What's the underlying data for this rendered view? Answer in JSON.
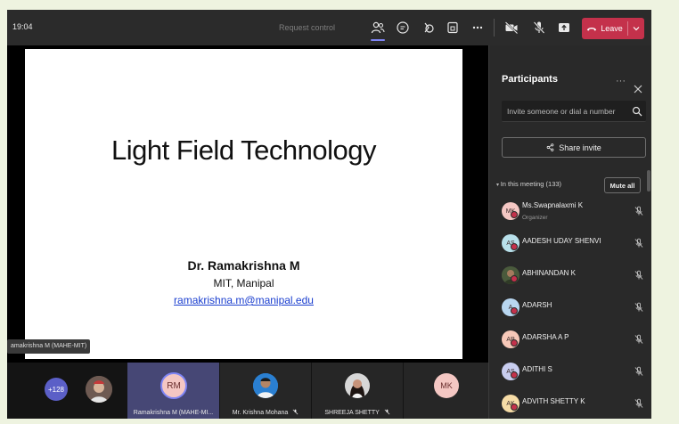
{
  "toolbar": {
    "time": "19:04",
    "request_control": "Request control",
    "leave_label": "Leave",
    "colors": {
      "leave": "#c4314b",
      "accent": "#7f85f5"
    }
  },
  "slide": {
    "title": "Light Field Technology",
    "author": "Dr. Ramakrishna M",
    "affiliation": "MIT, Manipal",
    "email": "ramakrishna.m@manipal.edu"
  },
  "presenter_label": "amakrishna M (MAHE-MIT)",
  "gallery": {
    "overflow_count": "+128",
    "tiles": [
      {
        "initials": "RM",
        "name": "Ramakrishna M (MAHE-MI...",
        "active": true
      },
      {
        "initials": "",
        "name": "Mr. Krishna Mohana",
        "muted_icon": "mic-off-icon"
      },
      {
        "initials": "",
        "name": "SHREEJA SHETTY",
        "muted_icon": "mic-off-icon"
      },
      {
        "initials": "MK",
        "name": ""
      }
    ]
  },
  "participants": {
    "title": "Participants",
    "search_placeholder": "Invite someone or dial a number",
    "share_invite": "Share invite",
    "section_label": "In this meeting (133)",
    "mute_all": "Mute all",
    "list": [
      {
        "initials": "MK",
        "name": "Ms.Swapnalaxmi K",
        "role": "Organizer",
        "color": "#f4c7c3"
      },
      {
        "initials": "AS",
        "name": "AADESH UDAY SHENVI",
        "role": "",
        "color": "#b8e0ea"
      },
      {
        "initials": "",
        "name": "ABHINANDAN K",
        "role": "",
        "color": "#4a5a3c"
      },
      {
        "initials": "A",
        "name": "ADARSH",
        "role": "",
        "color": "#b8d6f0"
      },
      {
        "initials": "AP",
        "name": "ADARSHA A P",
        "role": "",
        "color": "#f7c8b8"
      },
      {
        "initials": "AS",
        "name": "ADITHI S",
        "role": "",
        "color": "#c8cdef"
      },
      {
        "initials": "AK",
        "name": "ADVITH SHETTY K",
        "role": "",
        "color": "#f6dca6"
      }
    ]
  }
}
